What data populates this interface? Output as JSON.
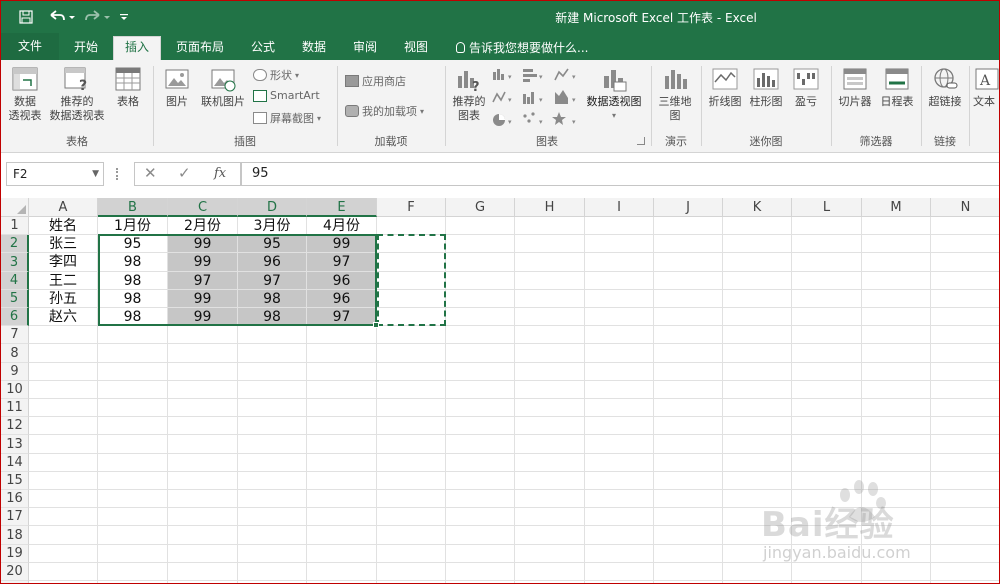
{
  "window": {
    "title": "新建 Microsoft Excel 工作表 - Excel"
  },
  "quick_access": {
    "save_icon": "save-icon",
    "undo_icon": "undo-icon",
    "redo_icon": "redo-icon",
    "customize_icon": "customize-icon"
  },
  "tabs": [
    "文件",
    "开始",
    "插入",
    "页面布局",
    "公式",
    "数据",
    "审阅",
    "视图"
  ],
  "active_tab": "插入",
  "tell_me": "告诉我您想要做什么...",
  "ribbon": {
    "tables": {
      "label": "表格",
      "pivot": [
        "数据",
        "透视表"
      ],
      "recommended_pivot": [
        "推荐的",
        "数据透视表"
      ],
      "table": "表格"
    },
    "illustrations": {
      "label": "插图",
      "pictures": "图片",
      "online_pictures": "联机图片",
      "shapes": "形状",
      "smartart": "SmartArt",
      "screenshot": "屏幕截图"
    },
    "addins": {
      "label": "加载项",
      "store": "应用商店",
      "my_addins": "我的加载项"
    },
    "charts": {
      "label": "图表",
      "recommended": [
        "推荐的",
        "图表"
      ],
      "pivot_chart": "数据透视图"
    },
    "tours": {
      "label": "演示",
      "map3d": [
        "三维地",
        "图"
      ]
    },
    "sparklines": {
      "label": "迷你图",
      "line": "折线图",
      "column": "柱形图",
      "winloss": "盈亏"
    },
    "filters": {
      "label": "筛选器",
      "slicer": "切片器",
      "timeline": "日程表"
    },
    "links": {
      "label": "链接",
      "hyperlink": "超链接"
    },
    "text": {
      "label": "文本"
    }
  },
  "formula_bar": {
    "name_box": "F2",
    "cancel": "✕",
    "enter": "✓",
    "fx": "fx",
    "value": "95"
  },
  "sheet": {
    "columns": [
      "A",
      "B",
      "C",
      "D",
      "E",
      "F",
      "G",
      "H",
      "I",
      "J",
      "K",
      "L",
      "M",
      "N"
    ],
    "rows": [
      "1",
      "2",
      "3",
      "4",
      "5",
      "6",
      "7",
      "8",
      "9",
      "10",
      "11",
      "12",
      "13",
      "14",
      "15",
      "16",
      "17",
      "18",
      "19",
      "20",
      "21"
    ],
    "data": [
      [
        "姓名",
        "1月份",
        "2月份",
        "3月份",
        "4月份"
      ],
      [
        "张三",
        "95",
        "99",
        "95",
        "99"
      ],
      [
        "李四",
        "98",
        "99",
        "96",
        "97"
      ],
      [
        "王二",
        "98",
        "97",
        "97",
        "96"
      ],
      [
        "孙五",
        "98",
        "99",
        "98",
        "96"
      ],
      [
        "赵六",
        "98",
        "99",
        "98",
        "97"
      ]
    ]
  },
  "watermark": {
    "text": "Bai经验",
    "url": "jingyan.baidu.com"
  },
  "colors": {
    "excel_green": "#217346",
    "selection_gray": "#c6c6c6",
    "ribbon_bg": "#f3f3f3"
  }
}
